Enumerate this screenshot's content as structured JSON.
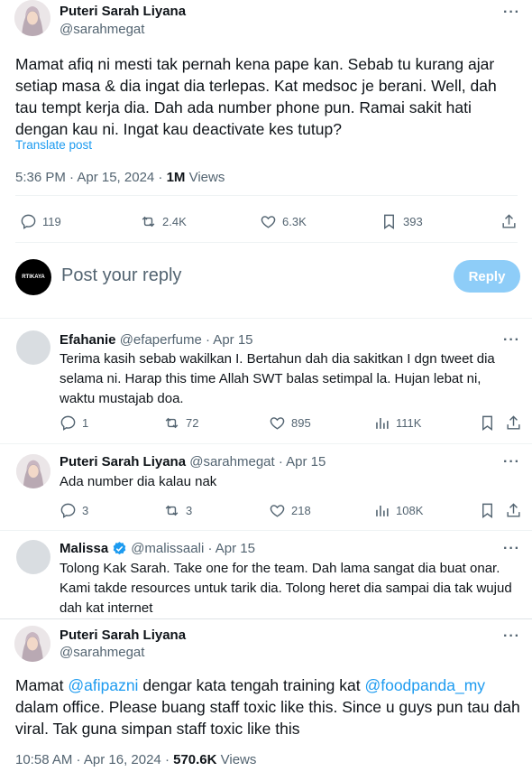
{
  "tweet1": {
    "author_name": "Puteri Sarah Liyana",
    "author_handle": "@sarahmegat",
    "more": "···",
    "text": "Mamat afiq ni mesti tak pernah kena pape kan. Sebab tu kurang ajar setiap masa & dia ingat dia terlepas. Kat medsoc je berani. Well, dah tau tempt kerja dia. Dah ada number phone pun. Ramai sakit hati dengan kau ni. Ingat kau deactivate kes tutup?",
    "translate": "Translate post",
    "timestamp": "5:36 PM · Apr 15, 2024 · ",
    "views_count": "1M",
    "views_label": " Views",
    "replies": "119",
    "reposts": "2.4K",
    "likes": "6.3K",
    "bookmarks": "393"
  },
  "compose": {
    "avatar_text": "RTIKAYA",
    "placeholder": "Post your reply",
    "reply_button": "Reply"
  },
  "replies": [
    {
      "name": "Efahanie",
      "handle": "@efaperfume · Apr 15",
      "text": "Terima kasih sebab wakilkan I. Bertahun dah dia sakitkan I dgn tweet dia selama ni. Harap this time Allah SWT balas setimpal la. Hujan lebat ni, waktu mustajab doa.",
      "replies": "1",
      "reposts": "72",
      "likes": "895",
      "views": "111K"
    },
    {
      "name": "Puteri Sarah Liyana",
      "handle": "@sarahmegat · Apr 15",
      "text": "Ada number dia kalau nak",
      "replies": "3",
      "reposts": "3",
      "likes": "218",
      "views": "108K"
    },
    {
      "name": "Malissa",
      "handle": "@malissaali · Apr 15",
      "text": "Tolong Kak Sarah. Take one for the team. Dah lama sangat dia buat onar. Kami takde resources untuk tarik dia. Tolong heret dia sampai dia tak wujud dah kat internet",
      "verified": true
    }
  ],
  "tweet2": {
    "author_name": "Puteri Sarah Liyana",
    "author_handle": "@sarahmegat",
    "text_pre": "Mamat ",
    "mention1": "@afipazni",
    "text_mid": " dengar kata tengah training kat ",
    "mention2": "@foodpanda_my",
    "text_post": " dalam office. Please buang staff toxic like this. Since u guys pun tau dah viral. Tak guna simpan staff toxic like this",
    "timestamp": "10:58 AM · Apr 16, 2024 · ",
    "views_count": "570.6K",
    "views_label": " Views"
  },
  "colors": {
    "accent": "#1d9bf0",
    "muted": "#536471",
    "text": "#0f1419",
    "reply_button": "#8ecdf8"
  }
}
